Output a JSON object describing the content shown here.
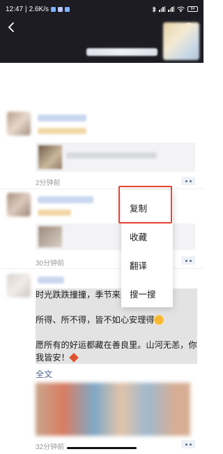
{
  "status_bar": {
    "time": "12:47",
    "net_speed": "2.6K/s",
    "separator": "|",
    "battery": "84"
  },
  "posts": [
    {
      "time": "2分钟前"
    },
    {
      "time": "30分钟前"
    },
    {
      "lines": [
        "时光跌跌撞撞，季节来来往往，",
        "",
        "所得、所不得，皆不如心安理得",
        "",
        "愿所有的好运都藏在善良里。山河无恙，你",
        "我皆安！"
      ],
      "full_text": "全文",
      "time": "32分钟前"
    }
  ],
  "context_menu": {
    "items": [
      "复制",
      "收藏",
      "翻译",
      "搜一搜"
    ],
    "highlighted": "复制"
  },
  "colors": {
    "header_bg": "#1c1c22",
    "link_blue": "#576b95",
    "highlight_red": "#e8432f"
  },
  "icons": [
    "back-arrow-icon",
    "camera-icon",
    "more-dots-icon",
    "sun-emoji-icon",
    "fu-emoji-icon"
  ]
}
